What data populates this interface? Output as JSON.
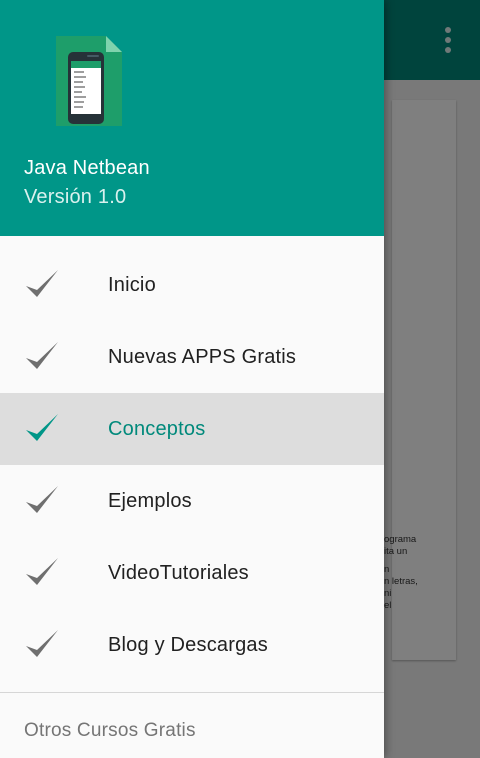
{
  "colors": {
    "primary": "#009688",
    "primary_dark": "#00897b",
    "accent_selected": "#00897b",
    "icon_default": "#6f6f6f",
    "selected_bg": "#dddddd"
  },
  "header": {
    "app_name": "Java Netbean",
    "version": "Versión 1.0",
    "icon": "phone-app-icon"
  },
  "menu": {
    "items": [
      {
        "label": "Inicio",
        "icon": "check-icon",
        "selected": false
      },
      {
        "label": "Nuevas APPS Gratis",
        "icon": "check-icon",
        "selected": false
      },
      {
        "label": "Conceptos",
        "icon": "check-icon",
        "selected": true
      },
      {
        "label": "Ejemplos",
        "icon": "check-icon",
        "selected": false
      },
      {
        "label": "VideoTutoriales",
        "icon": "check-icon",
        "selected": false
      },
      {
        "label": "Blog y Descargas",
        "icon": "check-icon",
        "selected": false
      }
    ],
    "section_label": "Otros Cursos Gratis"
  },
  "background": {
    "toolbar_icon": "more-vert-icon",
    "content_fragments": [
      "ograma",
      "ita un",
      "",
      "n",
      "n letras,",
      "ni",
      "el"
    ]
  }
}
